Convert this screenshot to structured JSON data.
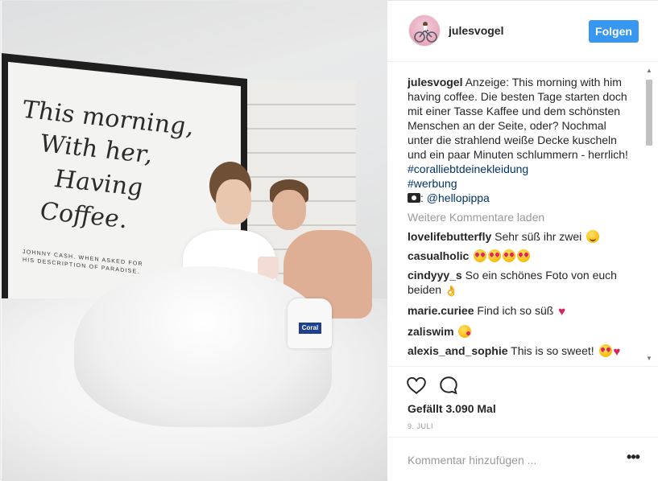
{
  "post": {
    "image_alt": "Couple in bed with coffee and Coral detergent bottle",
    "poster": {
      "lines": [
        "This morning,",
        "With her,",
        "Having",
        "Coffee."
      ],
      "caption_line1": "JOHNNY CASH. WHEN ASKED FOR",
      "caption_line2": "HIS DESCRIPTION OF PARADISE."
    },
    "bottle_label": "Coral"
  },
  "header": {
    "username": "julesvogel",
    "follow_label": "Folgen",
    "avatar_icon": "avatar-bicycle-icon"
  },
  "caption": {
    "username": "julesvogel",
    "text": " Anzeige: This morning with him having coffee. Die besten Tage starten doch mit einer Tasse Kaffee und dem schönsten Menschen an der Seite, oder? Nochmal unter die strahlend weiße Decke kuscheln und ein paar Minuten schlummern - herrlich! ",
    "hashtag1": "#coralliebtdeinekleidung",
    "hashtag2": "#werbung",
    "camera_icon": "camera-icon",
    "credit_sep": ": ",
    "credit_mention": "@hellopippa"
  },
  "load_more": "Weitere Kommentare laden",
  "comments": [
    {
      "user": "lovelifebutterfly",
      "text": " Sehr süß ihr zwei "
    },
    {
      "user": "casualholic",
      "text": " "
    },
    {
      "user": "cindyyy_s",
      "text": " So ein schönes Foto von euch beiden "
    },
    {
      "user": "marie.curiee",
      "text": " Find ich so süß "
    },
    {
      "user": "zaliswim",
      "text": " "
    },
    {
      "user": "alexis_and_sophie",
      "text": " This is so sweet! "
    }
  ],
  "actions": {
    "like_icon": "heart-outline-icon",
    "comment_icon": "comment-bubble-icon",
    "likes_text": "Gefällt 3.090 Mal",
    "date": "9. JULI"
  },
  "add_comment": {
    "placeholder": "Kommentar hinzufügen ...",
    "more_label": "•••"
  },
  "colors": {
    "follow_button": "#3897f0",
    "link": "#003569",
    "muted": "#999999",
    "text": "#262626"
  }
}
